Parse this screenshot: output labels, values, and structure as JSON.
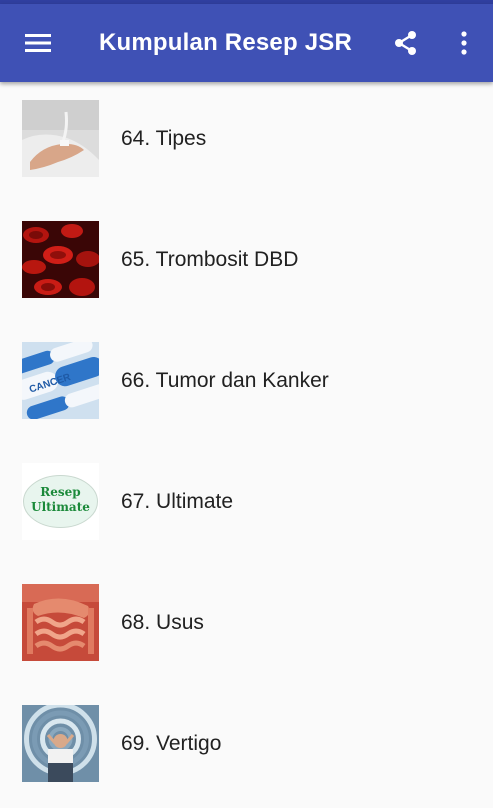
{
  "appbar": {
    "title": "Kumpulan Resep JSR",
    "menu_icon": "menu-icon",
    "share_icon": "share-icon",
    "more_icon": "more-vert-icon",
    "color": "#3f51b5"
  },
  "items": [
    {
      "label": "64. Tipes",
      "thumb": "iv-drip-hand-image"
    },
    {
      "label": "65. Trombosit DBD",
      "thumb": "red-blood-cells-image"
    },
    {
      "label": "66. Tumor dan Kanker",
      "thumb": "cancer-pills-image",
      "thumb_text": "CANCER"
    },
    {
      "label": "67. Ultimate",
      "thumb": "resep-ultimate-logo",
      "thumb_text_1": "Resep",
      "thumb_text_2": "Ultimate"
    },
    {
      "label": "68. Usus",
      "thumb": "intestine-image"
    },
    {
      "label": "69. Vertigo",
      "thumb": "vertigo-image"
    }
  ]
}
